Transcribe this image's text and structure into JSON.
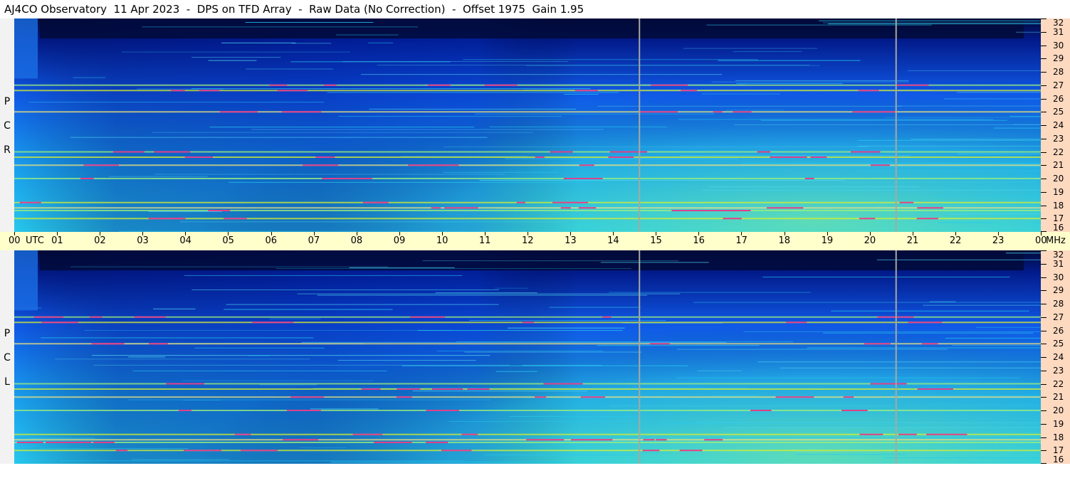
{
  "title": "AJ4CO Observatory  11 Apr 2023  -  DPS on TFD Array  -  Raw Data (No Correction)  -  Offset 1975  Gain 1.95",
  "panels": [
    {
      "polarization_letters": [
        "P",
        "C",
        "R"
      ]
    },
    {
      "polarization_letters": [
        "P",
        "C",
        "L"
      ]
    }
  ],
  "chart_data": {
    "type": "heatmap",
    "description_free": true,
    "x": {
      "unit_label": "UTC",
      "tick_labels": [
        "00",
        "01",
        "02",
        "03",
        "04",
        "05",
        "06",
        "07",
        "08",
        "09",
        "10",
        "11",
        "12",
        "13",
        "14",
        "15",
        "16",
        "17",
        "18",
        "19",
        "20",
        "21",
        "22",
        "23",
        "00"
      ],
      "range": [
        0,
        24
      ]
    },
    "y": {
      "unit_label": "MHz",
      "tick_labels": [
        "16",
        "17",
        "18",
        "19",
        "20",
        "21",
        "22",
        "23",
        "24",
        "25",
        "26",
        "27",
        "28",
        "29",
        "30",
        "31",
        "32"
      ],
      "range": [
        16,
        32
      ]
    },
    "series": [
      {
        "polarization": "RCP"
      },
      {
        "polarization": "LCP"
      }
    ],
    "interference_lines_mhz": [
      17.0,
      17.6,
      17.8,
      18.2,
      20.0,
      21.0,
      21.6,
      22.0,
      25.0,
      26.6,
      27.0
    ],
    "vertical_artifacts_utc": [
      14.6,
      20.6
    ],
    "colors": {
      "low": "#010a3a",
      "mid": "#0f58e6",
      "high": "#27c8ee",
      "peak": "#d6ee30",
      "hot": "#e0408c",
      "time_axis_bg": "#ffffcc",
      "freq_axis_bg": "#fdd9c0"
    }
  }
}
